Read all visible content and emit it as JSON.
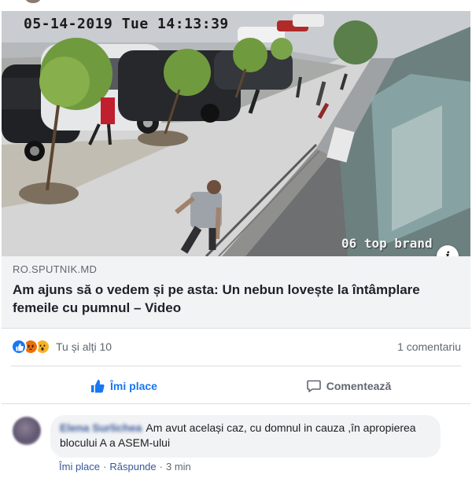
{
  "post": {
    "media": {
      "timestamp": "05-14-2019 Tue 14:13:39",
      "watermark": "06 top brand",
      "info_icon": "info-icon"
    },
    "link": {
      "domain": "RO.SPUTNIK.MD",
      "title": "Am ajuns să o vedem și pe asta: Un nebun lovește la întâmplare femeile cu pumnul – Video"
    },
    "reactions": {
      "icons": [
        "like-reaction-icon",
        "angry-reaction-icon",
        "wow-reaction-icon"
      ],
      "summary": "Tu și alți 10",
      "comments_count": "1 comentariu"
    },
    "actions": {
      "like_label": "Îmi place",
      "comment_label": "Comentează",
      "like_color": "#1877f2"
    }
  },
  "comment": {
    "author": "Elena Surlichea",
    "text": "Am avut același caz, cu domnul in cauza ,în apropierea blocului A a ASEM-ului",
    "like_label": "Îmi place",
    "reply_label": "Răspunde",
    "time": "3 min"
  }
}
